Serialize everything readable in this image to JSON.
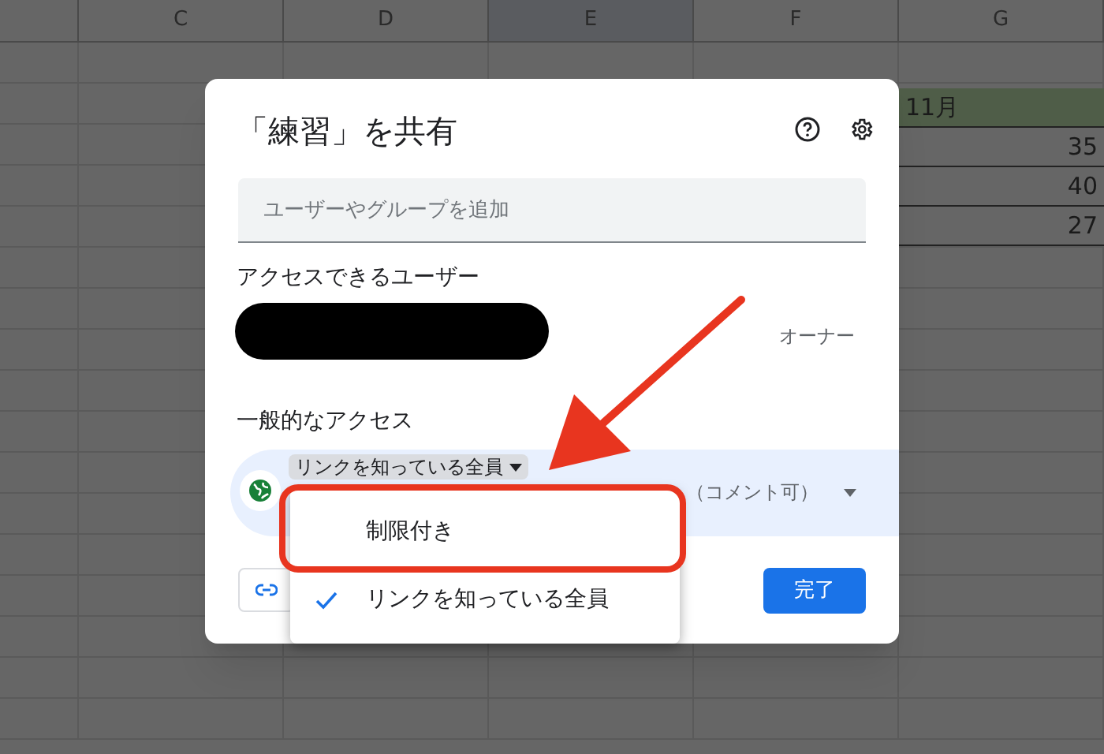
{
  "sheet": {
    "columns": [
      {
        "label": "C",
        "selected": false
      },
      {
        "label": "D",
        "selected": false
      },
      {
        "label": "E",
        "selected": true
      },
      {
        "label": "F",
        "selected": false
      },
      {
        "label": "G",
        "selected": false
      }
    ],
    "column_g_cells": [
      {
        "text": "11月",
        "kind": "header"
      },
      {
        "text": "35",
        "kind": "number"
      },
      {
        "text": "40",
        "kind": "number"
      },
      {
        "text": "27",
        "kind": "number"
      }
    ]
  },
  "dialog": {
    "title": "「練習」を共有",
    "add_field": {
      "placeholder": "ユーザーやグループを追加"
    },
    "people_heading": "アクセスできるユーザー",
    "owner_role": "オーナー",
    "general_heading": "一般的なアクセス",
    "access_button": "リンクを知っている全員",
    "role_text": "（コメント可）",
    "menu": [
      {
        "label": "制限付き",
        "checked": false,
        "highlighted": true
      },
      {
        "label": "リンクを知っている全員",
        "checked": true,
        "highlighted": false
      }
    ],
    "done_button": "完了"
  }
}
